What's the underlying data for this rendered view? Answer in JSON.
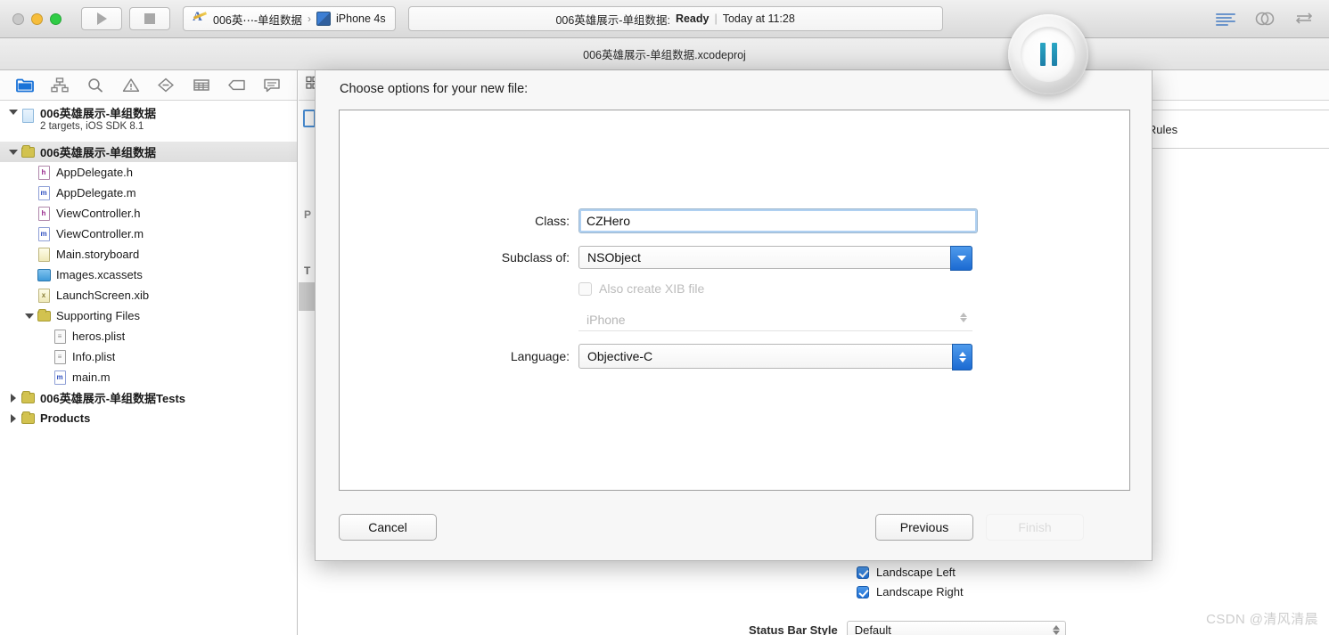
{
  "toolbar": {
    "run_label": "Run",
    "stop_label": "Stop",
    "scheme_project": "006英⋯-单组数据",
    "scheme_separator": "›",
    "scheme_device": "iPhone 4s",
    "status_project": "006英雄展示-单组数据:",
    "status_state": "Ready",
    "status_divider": "|",
    "status_time": "Today at 11:28",
    "editor_standard": "standard-editor",
    "editor_assistant": "assistant-editor",
    "editor_version": "version-editor"
  },
  "window": {
    "title": "006英雄展示-单组数据.xcodeproj"
  },
  "navigator": {
    "icons": [
      {
        "name": "project-navigator",
        "active": true
      },
      {
        "name": "symbol-navigator",
        "active": false
      },
      {
        "name": "find-navigator",
        "active": false
      },
      {
        "name": "issue-navigator",
        "active": false
      },
      {
        "name": "test-navigator",
        "active": false
      },
      {
        "name": "debug-navigator",
        "active": false
      },
      {
        "name": "breakpoint-navigator",
        "active": false
      },
      {
        "name": "report-navigator",
        "active": false
      }
    ],
    "project": {
      "name": "006英雄展示-单组数据",
      "subtitle": "2 targets, iOS SDK 8.1"
    },
    "items": [
      {
        "label": "006英雄展示-单组数据",
        "type": "folder",
        "indent": 1,
        "twisty": "down",
        "selected": true
      },
      {
        "label": "AppDelegate.h",
        "type": "h",
        "indent": 2,
        "twisty": "none",
        "selected": false
      },
      {
        "label": "AppDelegate.m",
        "type": "m",
        "indent": 2,
        "twisty": "none",
        "selected": false
      },
      {
        "label": "ViewController.h",
        "type": "h",
        "indent": 2,
        "twisty": "none",
        "selected": false
      },
      {
        "label": "ViewController.m",
        "type": "m",
        "indent": 2,
        "twisty": "none",
        "selected": false
      },
      {
        "label": "Main.storyboard",
        "type": "sb",
        "indent": 2,
        "twisty": "none",
        "selected": false
      },
      {
        "label": "Images.xcassets",
        "type": "xcass",
        "indent": 2,
        "twisty": "none",
        "selected": false
      },
      {
        "label": "LaunchScreen.xib",
        "type": "xib",
        "indent": 2,
        "twisty": "none",
        "selected": false
      },
      {
        "label": "Supporting Files",
        "type": "folder",
        "indent": 2,
        "twisty": "down",
        "selected": false
      },
      {
        "label": "heros.plist",
        "type": "plist",
        "indent": 3,
        "twisty": "none",
        "selected": false
      },
      {
        "label": "Info.plist",
        "type": "plist",
        "indent": 3,
        "twisty": "none",
        "selected": false
      },
      {
        "label": "main.m",
        "type": "m",
        "indent": 3,
        "twisty": "none",
        "selected": false
      },
      {
        "label": "006英雄展示-单组数据Tests",
        "type": "folder",
        "indent": 1,
        "twisty": "right",
        "selected": false
      },
      {
        "label": "Products",
        "type": "folder",
        "indent": 1,
        "twisty": "right",
        "selected": false
      }
    ]
  },
  "editor_behind": {
    "rules_tab_partial": "d Rules",
    "ghost_p": "P",
    "ghost_t": "T",
    "orientation": {
      "landscape_left": "Landscape Left",
      "landscape_right": "Landscape Right"
    },
    "status_bar_style_label": "Status Bar Style",
    "status_bar_style_value": "Default"
  },
  "dialog": {
    "title": "Choose options for your new file:",
    "fields": {
      "class_label": "Class:",
      "class_value": "CZHero",
      "subclass_label": "Subclass of:",
      "subclass_value": "NSObject",
      "xib_checkbox_label": "Also create XIB file",
      "device_value": "iPhone",
      "language_label": "Language:",
      "language_value": "Objective-C"
    },
    "buttons": {
      "cancel": "Cancel",
      "previous": "Previous",
      "finish": "Finish"
    }
  },
  "hud": {
    "name": "pause-indicator"
  },
  "watermark": {
    "text": "CSDN @清风清晨"
  },
  "colors": {
    "accent_blue": "#1b6ad2",
    "checkbox_blue": "#2f7fdc",
    "folder_yellow": "#d2c24f",
    "pause_teal": "#2aa6c4"
  }
}
